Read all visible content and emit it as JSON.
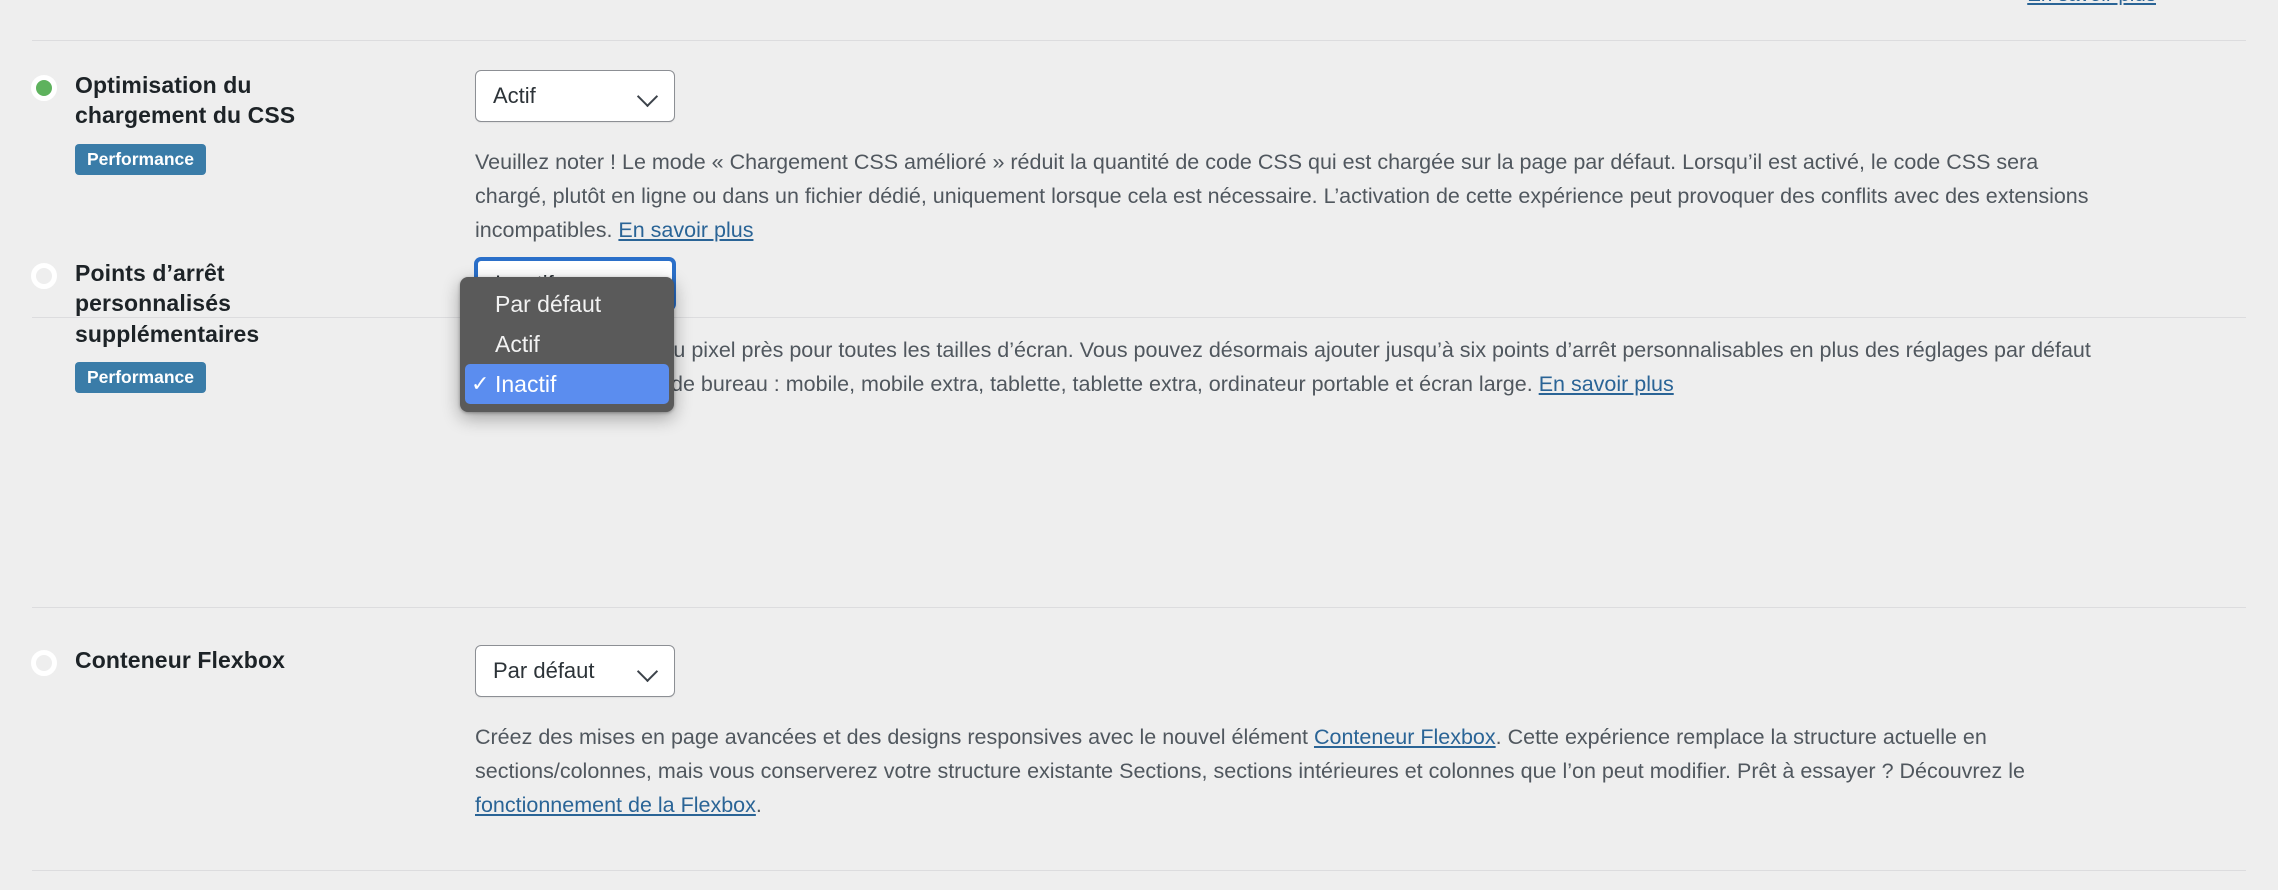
{
  "colors": {
    "page_background": "#eeeeee",
    "badge_blue": "#3a7ca8",
    "link_blue": "#2a6496",
    "status_active_green": "#5eb25d",
    "dropdown_background": "#5a5a5a",
    "dropdown_selected_blue": "#5b8def",
    "select_focus_blue": "#2a6fc9"
  },
  "top_cut_row": {
    "link_label": "En savoir plus"
  },
  "features": [
    {
      "id": "css-loading-optimization",
      "status": "active",
      "status_icon": "status-dot-green",
      "title": "Optimisation du chargement du CSS",
      "badge": "Performance",
      "select": {
        "value": "Actif",
        "icon": "chevron-down-icon",
        "focused": false
      },
      "description_parts": [
        {
          "type": "text",
          "text": "Veuillez noter ! Le mode « Chargement CSS amélioré » réduit la quantité de code CSS qui est chargée sur la page par défaut. Lorsqu’il est activé, le code CSS sera chargé, plutôt en ligne ou dans un fichier dédié, uniquement lorsque cela est nécessaire. L’activation de cette expérience peut provoquer des conflits avec des extensions incompatibles. "
        },
        {
          "type": "link",
          "text": "En savoir plus"
        }
      ]
    },
    {
      "id": "additional-custom-breakpoints",
      "status": "inactive",
      "status_icon": "status-dot-empty",
      "title": "Points d’arrêt personnalisés supplémentaires",
      "badge": "Performance",
      "select": {
        "value": "Inactif",
        "icon": "chevron-down-icon",
        "focused": true
      },
      "description_parts": [
        {
          "type": "text",
          "text": "Obtenez un design au pixel près pour toutes les tailles d’écran. Vous pouvez désormais ajouter jusqu’à six points d’arrêt personnalisables en plus des réglages par défaut pour les ordinateurs de bureau : mobile, mobile extra, tablette, tablette extra, ordinateur portable et écran large. "
        },
        {
          "type": "link",
          "text": "En savoir plus"
        }
      ]
    },
    {
      "id": "flexbox-container",
      "status": "inactive",
      "status_icon": "status-dot-empty",
      "title": "Conteneur Flexbox",
      "badge": null,
      "select": {
        "value": "Par défaut",
        "icon": "chevron-down-icon",
        "focused": false
      },
      "description_parts": [
        {
          "type": "text",
          "text": "Créez des mises en page avancées et des designs responsives avec le nouvel élément "
        },
        {
          "type": "link",
          "text": "Conteneur Flexbox"
        },
        {
          "type": "text",
          "text": ". Cette expérience remplace la structure actuelle en sections/colonnes, mais vous conserverez votre structure existante Sections, sections intérieures et colonnes que l’on peut modifier. Prêt à essayer ? Découvrez le "
        },
        {
          "type": "link",
          "text": "fonctionnement de la Flexbox"
        },
        {
          "type": "text",
          "text": "."
        }
      ]
    }
  ],
  "open_dropdown": {
    "belongs_to": "additional-custom-breakpoints",
    "options": [
      {
        "label": "Par défaut",
        "selected": false
      },
      {
        "label": "Actif",
        "selected": false
      },
      {
        "label": "Inactif",
        "selected": true
      }
    ],
    "check_glyph": "✓"
  }
}
